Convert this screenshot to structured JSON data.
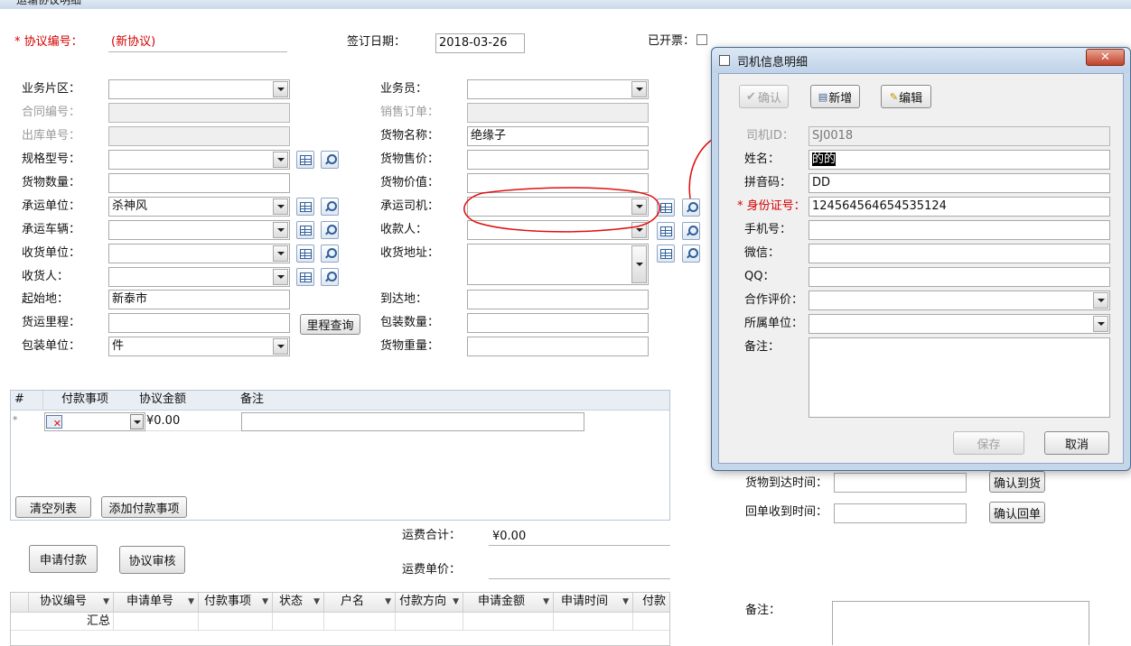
{
  "window": {
    "title": "运输协议明细"
  },
  "form": {
    "protocol_no_label": "* 协议编号：",
    "protocol_no_value": "(新协议)",
    "sign_date_label": "签订日期：",
    "sign_date_value": "2018-03-26",
    "invoiced_label": "已开票：",
    "left": [
      {
        "label": "业务片区：",
        "value": ""
      },
      {
        "label": "合同编号：",
        "value": ""
      },
      {
        "label": "出库单号：",
        "value": ""
      },
      {
        "label": "规格型号：",
        "value": ""
      },
      {
        "label": "货物数量：",
        "value": ""
      },
      {
        "label": "承运单位：",
        "value": "杀神风"
      },
      {
        "label": "承运车辆：",
        "value": ""
      },
      {
        "label": "收货单位：",
        "value": ""
      },
      {
        "label": "收货人：",
        "value": ""
      },
      {
        "label": "起始地：",
        "value": "新泰市"
      },
      {
        "label": "货运里程：",
        "value": ""
      },
      {
        "label": "包装单位：",
        "value": "件"
      }
    ],
    "right": [
      {
        "label": "业务员：",
        "value": ""
      },
      {
        "label": "销售订单：",
        "value": ""
      },
      {
        "label": "货物名称：",
        "value": "绝缘子"
      },
      {
        "label": "货物售价：",
        "value": ""
      },
      {
        "label": "货物价值：",
        "value": ""
      },
      {
        "label": "承运司机：",
        "value": ""
      },
      {
        "label": "收款人：",
        "value": ""
      },
      {
        "label": "收货地址：",
        "value": ""
      },
      {
        "label": "到达地：",
        "value": ""
      },
      {
        "label": "包装数量：",
        "value": ""
      },
      {
        "label": "货物重量：",
        "value": ""
      }
    ],
    "mileage_button": "里程查询"
  },
  "payment_grid": {
    "columns": [
      "#",
      "付款事项",
      "协议金额",
      "备注"
    ],
    "new_row_marker": "*",
    "new_row_amount": "¥0.00",
    "clear_button": "清空列表",
    "add_button": "添加付款事项"
  },
  "totals": {
    "freight_total_label": "运费合计：",
    "freight_total_value": "¥0.00",
    "freight_unit_label": "运费单价："
  },
  "actions": {
    "apply_payment": "申请付款",
    "protocol_review": "协议审核"
  },
  "request_grid": {
    "columns": [
      "协议编号",
      "申请单号",
      "付款事项",
      "状态",
      "户名",
      "付款方向",
      "申请金额",
      "申请时间",
      "付款"
    ],
    "summary_label": "汇总"
  },
  "delivery": {
    "arrival_label": "货物到达时间：",
    "arrival_button": "确认到货",
    "receipt_label": "回单收到时间：",
    "receipt_button": "确认回单",
    "remark_label": "备注："
  },
  "dialog": {
    "title": "司机信息明细",
    "confirm_button": "确认",
    "new_button": "新增",
    "edit_button": "编辑",
    "fields": [
      {
        "label": "司机ID：",
        "value": "SJ0018"
      },
      {
        "label": "姓名：",
        "value": "的的"
      },
      {
        "label": "拼音码：",
        "value": "DD"
      },
      {
        "label": "* 身份证号：",
        "value": "124564564654535124"
      },
      {
        "label": "手机号：",
        "value": ""
      },
      {
        "label": "微信：",
        "value": ""
      },
      {
        "label": "QQ：",
        "value": ""
      },
      {
        "label": "合作评价：",
        "value": ""
      },
      {
        "label": "所属单位：",
        "value": ""
      },
      {
        "label": "备注：",
        "value": ""
      }
    ],
    "save_button": "保存",
    "cancel_button": "取消"
  },
  "colors": {
    "required": "#d40000",
    "annotation": "#e01010",
    "dialog_frame": "#c4d6ea"
  }
}
